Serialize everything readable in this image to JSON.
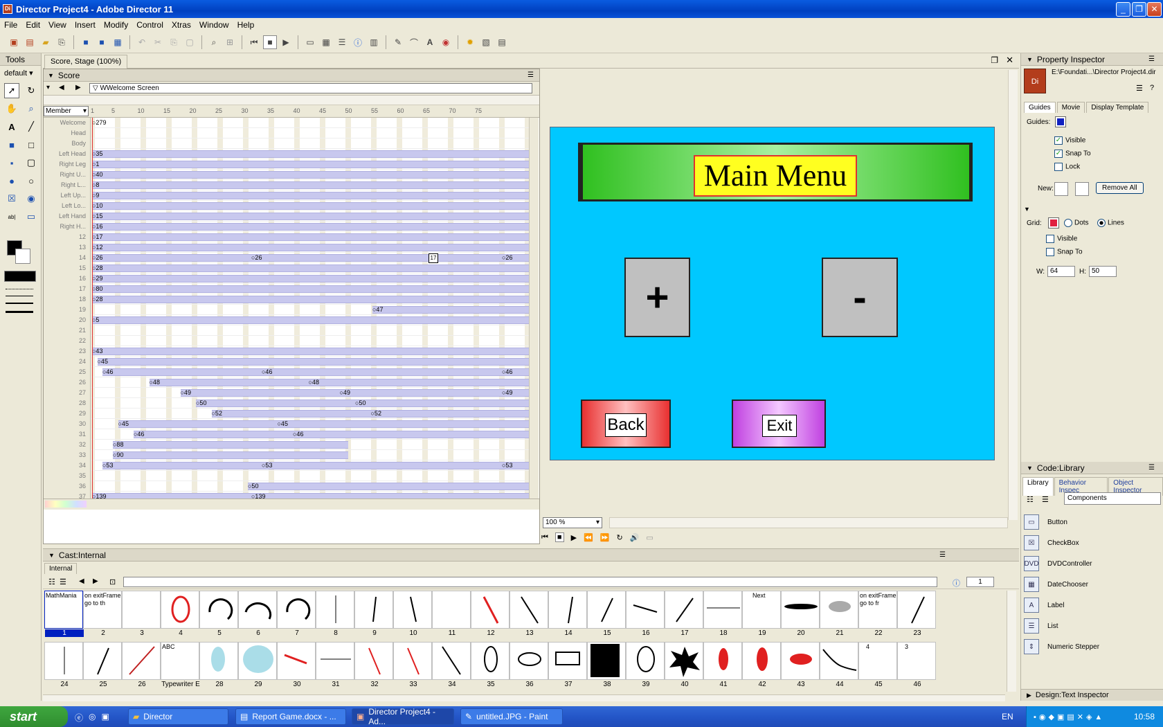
{
  "window": {
    "title": "Director Project4 - Adobe Director 11"
  },
  "menu": [
    "File",
    "Edit",
    "View",
    "Insert",
    "Modify",
    "Control",
    "Xtras",
    "Window",
    "Help"
  ],
  "tools_panel": {
    "title": "Tools",
    "preset": "default"
  },
  "doc_tab": "Score, Stage (100%)",
  "score": {
    "title": "Score",
    "marker": "WWelcome Screen",
    "member_dropdown": "Member",
    "frame_ticks": [
      "1",
      "5",
      "10",
      "15",
      "20",
      "25",
      "30",
      "35",
      "40",
      "45",
      "50",
      "55",
      "60",
      "65",
      "70",
      "75"
    ],
    "playhead_label": "17",
    "rows": [
      {
        "label": "Welcome",
        "start": 1,
        "text": "279",
        "full": false
      },
      {
        "label": "Head",
        "start": null,
        "text": "",
        "full": false
      },
      {
        "label": "Body",
        "start": null,
        "text": "",
        "full": false
      },
      {
        "label": "Left Head",
        "start": 1,
        "text": "35",
        "full": true
      },
      {
        "label": "Right Leg",
        "start": 1,
        "text": "1",
        "full": true
      },
      {
        "label": "Right U...",
        "start": 1,
        "text": "40",
        "full": true
      },
      {
        "label": "Right L...",
        "start": 1,
        "text": "8",
        "full": true
      },
      {
        "label": "Left Up...",
        "start": 1,
        "text": "9",
        "full": true
      },
      {
        "label": "Left Lo...",
        "start": 1,
        "text": "10",
        "full": true
      },
      {
        "label": "Left Hand",
        "start": 1,
        "text": "15",
        "full": true
      },
      {
        "label": "Right H...",
        "start": 1,
        "text": "16",
        "full": true
      },
      {
        "label": "12",
        "start": 1,
        "text": "17",
        "full": true
      },
      {
        "label": "13",
        "start": 1,
        "text": "12",
        "full": true
      },
      {
        "label": "14",
        "start": 1,
        "text": "26",
        "full": true,
        "extra": [
          "26",
          "26"
        ]
      },
      {
        "label": "15",
        "start": 1,
        "text": "28",
        "full": true
      },
      {
        "label": "16",
        "start": 1,
        "text": "29",
        "full": true
      },
      {
        "label": "17",
        "start": 1,
        "text": "80",
        "full": true
      },
      {
        "label": "18",
        "start": 1,
        "text": "28",
        "full": true
      },
      {
        "label": "19",
        "start": 55,
        "text": "47",
        "full": true
      },
      {
        "label": "20",
        "start": 1,
        "text": "5",
        "full": true
      },
      {
        "label": "21",
        "start": null,
        "text": "",
        "full": false
      },
      {
        "label": "22",
        "start": null,
        "text": "",
        "full": false
      },
      {
        "label": "23",
        "start": 1,
        "text": "43",
        "full": true
      },
      {
        "label": "24",
        "start": 2,
        "text": "45",
        "full": true
      },
      {
        "label": "25",
        "start": 3,
        "text": "46",
        "full": true,
        "extra": [
          "46",
          "46"
        ]
      },
      {
        "label": "26",
        "start": 12,
        "text": "48",
        "full": true,
        "extra": [
          "48"
        ]
      },
      {
        "label": "27",
        "start": 18,
        "text": "49",
        "full": true,
        "extra": [
          "49",
          "49"
        ]
      },
      {
        "label": "28",
        "start": 21,
        "text": "50",
        "full": true,
        "extra": [
          "50"
        ]
      },
      {
        "label": "29",
        "start": 24,
        "text": "52",
        "full": true,
        "extra": [
          "52"
        ]
      },
      {
        "label": "30",
        "start": 6,
        "text": "45",
        "full": true,
        "extra": [
          "45"
        ]
      },
      {
        "label": "31",
        "start": 9,
        "text": "46",
        "full": true,
        "extra": [
          "46"
        ]
      },
      {
        "label": "32",
        "start": 5,
        "text": "88",
        "full": false
      },
      {
        "label": "33",
        "start": 5,
        "text": "90",
        "full": false
      },
      {
        "label": "34",
        "start": 3,
        "text": "53",
        "full": true,
        "extra": [
          "53",
          "53"
        ]
      },
      {
        "label": "35",
        "start": null,
        "text": "",
        "full": true
      },
      {
        "label": "36",
        "start": 31,
        "text": "50",
        "full": true
      },
      {
        "label": "37",
        "start": 1,
        "text": "139",
        "full": true,
        "extra": [
          "139"
        ]
      }
    ]
  },
  "stage": {
    "zoom": "100 %",
    "heading": "Main Menu",
    "plus_label": "+",
    "minus_label": "-",
    "back_label": "Back",
    "exit_label": "Exit",
    "bg_color": "#00c8ff"
  },
  "property_inspector": {
    "title": "Property Inspector",
    "path": "E:\\Foundati...\\Director Project4.dir",
    "tabs": [
      "Guides",
      "Movie",
      "Display Template"
    ],
    "guides_label": "Guides:",
    "visible_label": "Visible",
    "snap_label": "Snap To",
    "lock_label": "Lock",
    "new_label": "New:",
    "remove_all": "Remove All",
    "grid_label": "Grid:",
    "dots_label": "Dots",
    "lines_label": "Lines",
    "grid_visible": "Visible",
    "grid_snap": "Snap To",
    "w_label": "W:",
    "w_value": "64",
    "h_label": "H:",
    "h_value": "50"
  },
  "code_library": {
    "title": "Code:Library",
    "tabs": [
      "Library",
      "Behavior Inspec",
      "Object Inspector"
    ],
    "category": "Components",
    "items": [
      "Button",
      "CheckBox",
      "DVDController",
      "DateChooser",
      "Label",
      "List",
      "Numeric Stepper"
    ],
    "bottom_panel": "Design:Text Inspector"
  },
  "cast": {
    "title": "Cast:Internal",
    "tab": "Internal",
    "counter": "1",
    "members": [
      {
        "n": "1",
        "text": "MathMania"
      },
      {
        "n": "2",
        "text": "on exitFrame go to th"
      },
      {
        "n": "3",
        "text": ""
      },
      {
        "n": "4",
        "text": ""
      },
      {
        "n": "5",
        "text": ""
      },
      {
        "n": "6",
        "text": ""
      },
      {
        "n": "7",
        "text": ""
      },
      {
        "n": "8",
        "text": ""
      },
      {
        "n": "9",
        "text": ""
      },
      {
        "n": "10",
        "text": ""
      },
      {
        "n": "11",
        "text": ""
      },
      {
        "n": "12",
        "text": ""
      },
      {
        "n": "13",
        "text": ""
      },
      {
        "n": "14",
        "text": ""
      },
      {
        "n": "15",
        "text": ""
      },
      {
        "n": "16",
        "text": ""
      },
      {
        "n": "17",
        "text": ""
      },
      {
        "n": "18",
        "text": ""
      },
      {
        "n": "19",
        "text": "Next"
      },
      {
        "n": "20",
        "text": ""
      },
      {
        "n": "21",
        "text": ""
      },
      {
        "n": "22",
        "text": "on exitFrame go to fr"
      },
      {
        "n": "23",
        "text": ""
      },
      {
        "n": "24",
        "text": ""
      },
      {
        "n": "25",
        "text": ""
      },
      {
        "n": "26",
        "text": ""
      },
      {
        "n": "Typewriter E",
        "text": "ABC"
      },
      {
        "n": "28",
        "text": ""
      },
      {
        "n": "29",
        "text": ""
      },
      {
        "n": "30",
        "text": ""
      },
      {
        "n": "31",
        "text": ""
      },
      {
        "n": "32",
        "text": ""
      },
      {
        "n": "33",
        "text": ""
      },
      {
        "n": "34",
        "text": ""
      },
      {
        "n": "35",
        "text": ""
      },
      {
        "n": "36",
        "text": ""
      },
      {
        "n": "37",
        "text": ""
      },
      {
        "n": "38",
        "text": ""
      },
      {
        "n": "39",
        "text": ""
      },
      {
        "n": "40",
        "text": ""
      },
      {
        "n": "41",
        "text": ""
      },
      {
        "n": "42",
        "text": ""
      },
      {
        "n": "43",
        "text": ""
      },
      {
        "n": "44",
        "text": ""
      },
      {
        "n": "45",
        "text": "4"
      },
      {
        "n": "46",
        "text": "3"
      }
    ]
  },
  "taskbar": {
    "start": "start",
    "tasks": [
      "Director",
      "Report Game.docx - ...",
      "Director Project4 - Ad...",
      "untitled.JPG - Paint"
    ],
    "lang": "EN",
    "time": "10:58"
  }
}
